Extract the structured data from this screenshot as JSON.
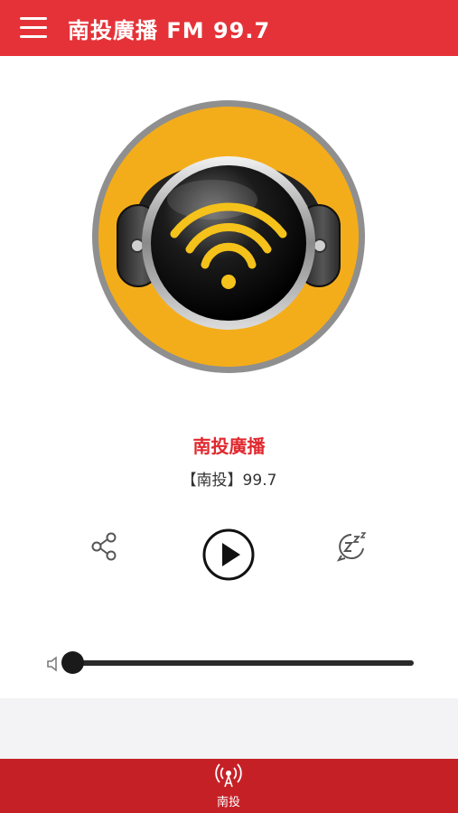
{
  "header": {
    "title": "南投廣播 FM 99.7",
    "menu_icon": "hamburger-menu-icon"
  },
  "station": {
    "name": "南投廣播",
    "subtitle": "【南投】99.7",
    "logo": "headphones-wifi-logo"
  },
  "controls": {
    "share_icon": "share-icon",
    "play_icon": "play-icon",
    "sleep_icon": "sleep-timer-icon"
  },
  "volume": {
    "icon": "speaker-icon",
    "level": 0
  },
  "tabs": [
    {
      "label": "南投",
      "icon": "radio-broadcast-icon"
    }
  ],
  "colors": {
    "brand_red": "#e53238",
    "tab_red": "#c62027",
    "station_name": "#e0282e",
    "logo_yellow": "#f4ad1a"
  }
}
